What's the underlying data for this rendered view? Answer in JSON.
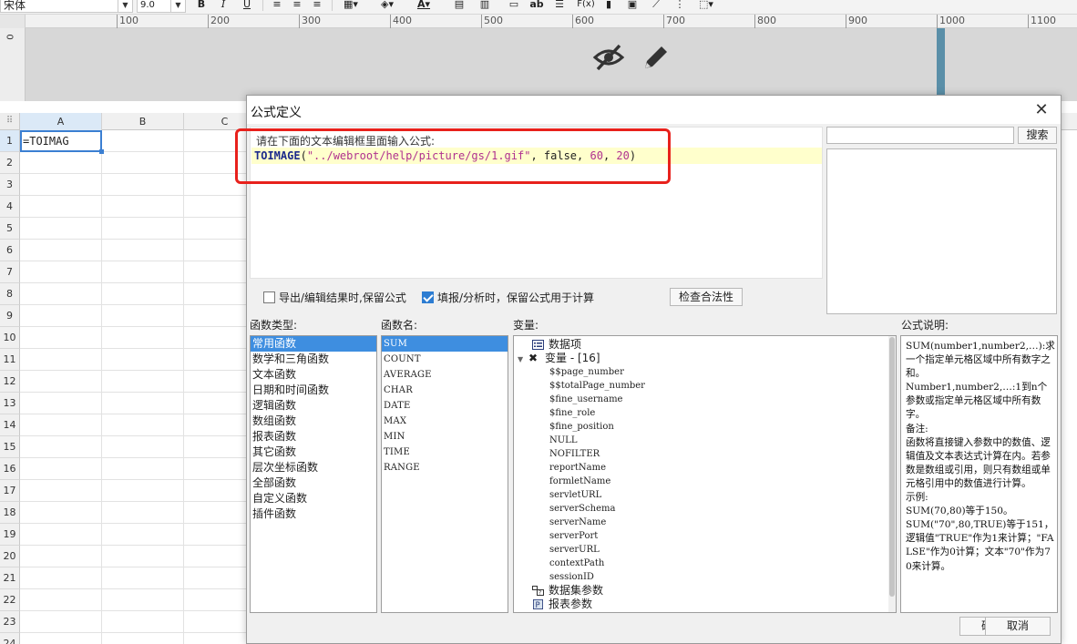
{
  "toolbar": {
    "font_name": "宋体",
    "font_size": "9.0",
    "bold": "B",
    "italic": "I",
    "underline": "U",
    "text_sample": "ab",
    "formula_btn": "F(x)",
    "font_color_btn": "A"
  },
  "ruler": {
    "marks": [
      "100",
      "200",
      "300",
      "400",
      "500",
      "600",
      "700",
      "800",
      "900",
      "1000",
      "1100"
    ],
    "vertical_mark": "0"
  },
  "sheet": {
    "columns": [
      "A",
      "B",
      "C"
    ],
    "rows": [
      "1",
      "2",
      "3",
      "4",
      "5",
      "6",
      "7",
      "8",
      "9",
      "10",
      "11",
      "12",
      "13",
      "14",
      "15",
      "16",
      "17",
      "18",
      "19",
      "20",
      "21",
      "22",
      "23",
      "24"
    ],
    "cell_a1": "=TOIMAG"
  },
  "dialog": {
    "title": "公式定义",
    "editor_hint": "请在下面的文本编辑框里面输入公式:",
    "formula": {
      "fn": "TOIMAGE",
      "open": "(",
      "arg1": "\"../webroot/help/picture/gs/1.gif\"",
      "rest": ", false, ",
      "arg3": "60",
      "sep": ", ",
      "arg4": "20",
      "close": ")"
    },
    "search_button": "搜索",
    "checkbox_export": "导出/编辑结果时,保留公式",
    "checkbox_fill": "填报/分析时，保留公式用于计算",
    "validate_button": "检查合法性",
    "labels": {
      "fn_type": "函数类型:",
      "fn_name": "函数名:",
      "variables": "变量:",
      "fn_desc": "公式说明:"
    },
    "fn_types": [
      "常用函数",
      "数学和三角函数",
      "文本函数",
      "日期和时间函数",
      "逻辑函数",
      "数组函数",
      "报表函数",
      "其它函数",
      "层次坐标函数",
      "全部函数",
      "自定义函数",
      "插件函数"
    ],
    "fn_names": [
      "SUM",
      "COUNT",
      "AVERAGE",
      "CHAR",
      "DATE",
      "MAX",
      "MIN",
      "TIME",
      "RANGE"
    ],
    "variables": {
      "data_item": "数据项",
      "var_group": "变量 - [16]",
      "items": [
        "$$page_number",
        "$$totalPage_number",
        "$fine_username",
        "$fine_role",
        "$fine_position",
        "NULL",
        "NOFILTER",
        "reportName",
        "formletName",
        "servletURL",
        "serverSchema",
        "serverName",
        "serverPort",
        "serverURL",
        "contextPath",
        "sessionID"
      ],
      "dataset_params": "数据集参数",
      "report_params": "报表参数"
    },
    "description": [
      "SUM(number1,number2,…):求一个指定单元格区域中所有数字之和。",
      "Number1,number2,…:1到n个参数或指定单元格区域中所有数字。",
      "备注:",
      "函数将直接键入参数中的数值、逻辑值及文本表达式计算在内。若参数是数组或引用，则只有数组或单元格引用中的数值进行计算。",
      "示例:",
      "SUM(70,80)等于150。",
      "SUM(\"70\",80,TRUE)等于151，逻辑值\"TRUE\"作为1来计算；\"FALSE\"作为0计算；文本\"70\"作为70来计算。"
    ],
    "ok_button": "确定",
    "cancel_button": "取消"
  },
  "colors": {
    "selection": "#3e8ee0",
    "highlight_box": "#e8211c",
    "editor_line": "#ffffcc",
    "band": "#d7d7d7"
  }
}
